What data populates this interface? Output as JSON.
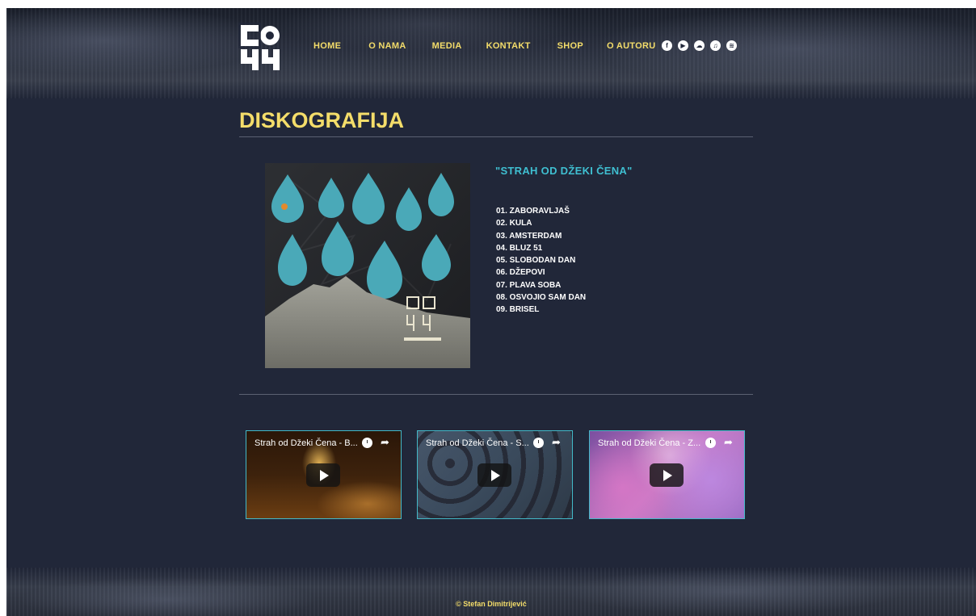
{
  "nav": {
    "items": [
      {
        "label": "HOME"
      },
      {
        "label": "O NAMA"
      },
      {
        "label": "MEDIA"
      },
      {
        "label": "KONTAKT"
      },
      {
        "label": "SHOP"
      },
      {
        "label": "O AUTORU"
      }
    ]
  },
  "social": {
    "icons": [
      "facebook-icon",
      "youtube-icon",
      "soundcloud-icon",
      "itunes-icon",
      "spotify-icon"
    ]
  },
  "page": {
    "title": "DISKOGRAFIJA"
  },
  "album": {
    "title": "\"STRAH OD DŽEKI ČENA\"",
    "tracks": [
      "01. ZABORAVLJAŠ",
      "02. KULA",
      "03. AMSTERDAM",
      "04. BLUZ 51",
      "05. SLOBODAN DAN",
      "06. DŽEPOVI",
      "07. PLAVA SOBA",
      "08. OSVOJIO SAM DAN",
      "09. BRISEL"
    ]
  },
  "videos": [
    {
      "title": "Strah od Džeki Čena - B..."
    },
    {
      "title": "Strah od Džeki Čena - S..."
    },
    {
      "title": "Strah od Džeki Čena - Z..."
    }
  ],
  "footer": {
    "text": "© Stefan Dimitrijević"
  },
  "colors": {
    "background": "#212739",
    "accent_yellow": "#f4dd6a",
    "accent_teal": "#3fbfd1"
  }
}
